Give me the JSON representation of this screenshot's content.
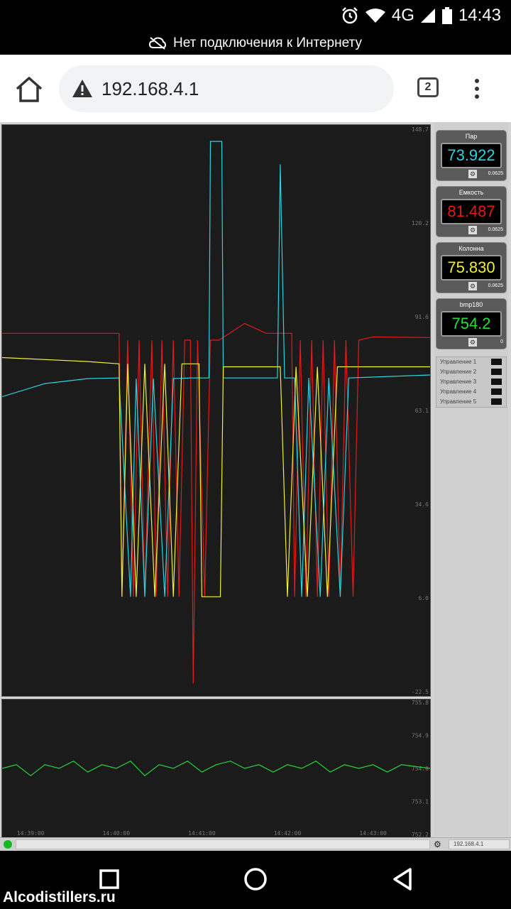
{
  "status_bar": {
    "time": "14:43",
    "network": "4G"
  },
  "offline_banner": {
    "text": "Нет подключения к Интернету"
  },
  "browser": {
    "url": "192.168.4.1",
    "tab_count": "2"
  },
  "main_chart": {
    "y_ticks": [
      "148.7",
      "120.2",
      "91.6",
      "63.1",
      "34.6",
      "6.0",
      "-22.5"
    ]
  },
  "pressure_chart": {
    "y_ticks": [
      "755.8",
      "754.9",
      "754.0",
      "753.1",
      "752.2"
    ],
    "x_ticks": [
      "14:39:00",
      "14:40:00",
      "14:41:00",
      "14:42:00",
      "14:43:00"
    ]
  },
  "gauges": [
    {
      "title": "Пар",
      "value": "73.922",
      "color": "#2ad4e0",
      "step": "0.0625"
    },
    {
      "title": "Емкость",
      "value": "81.487",
      "color": "#e21a1a",
      "step": "0.0625"
    },
    {
      "title": "Колонна",
      "value": "75.830",
      "color": "#f0ef3a",
      "step": "0.0625"
    },
    {
      "title": "bmp180",
      "value": "754.2",
      "color": "#25e03a",
      "step": "0"
    }
  ],
  "controls": [
    "Управление 1",
    "Управление 2",
    "Управление 3",
    "Управление 4",
    "Управление 5"
  ],
  "bottom_bar": {
    "ip": "192.168.4.1"
  },
  "watermark": "Alcodistillers.ru",
  "colors": {
    "steam": "#2ad4e0",
    "tank": "#e21a1a",
    "column": "#f0ef3a",
    "pressure": "#25d53a",
    "status_led": "#15b822"
  },
  "chart_data": [
    {
      "type": "line",
      "y_ticks": [
        148.7,
        120.2,
        91.6,
        63.1,
        34.6,
        6.0,
        -22.5
      ],
      "ylim": [
        -22.5,
        148.7
      ],
      "xlim": [
        "14:38:40",
        "14:43:40"
      ],
      "grid": false,
      "series": [
        {
          "color": "#e21a1a",
          "points": [
            [
              "14:38:40",
              86.6
            ],
            [
              "14:40:02",
              86.6
            ],
            [
              "14:40:04",
              6.4
            ],
            [
              "14:40:08",
              84.5
            ],
            [
              "14:40:12",
              6.4
            ],
            [
              "14:40:16",
              84.5
            ],
            [
              "14:40:20",
              6.4
            ],
            [
              "14:40:25",
              84.5
            ],
            [
              "14:40:28",
              6.4
            ],
            [
              "14:40:32",
              84.5
            ],
            [
              "14:40:36",
              6.4
            ],
            [
              "14:40:40",
              84.5
            ],
            [
              "14:40:44",
              6.4
            ],
            [
              "14:40:48",
              84.5
            ],
            [
              "14:40:52",
              84.5
            ],
            [
              "14:40:54",
              -20.0
            ],
            [
              "14:40:57",
              84.5
            ],
            [
              "14:41:02",
              6.4
            ],
            [
              "14:41:06",
              84.5
            ],
            [
              "14:41:12",
              84.5
            ],
            [
              "14:41:30",
              89.6
            ],
            [
              "14:41:45",
              86.6
            ],
            [
              "14:42:03",
              86.6
            ],
            [
              "14:42:05",
              6.4
            ],
            [
              "14:42:09",
              84.5
            ],
            [
              "14:42:13",
              6.4
            ],
            [
              "14:42:17",
              84.5
            ],
            [
              "14:42:21",
              6.4
            ],
            [
              "14:42:25",
              84.5
            ],
            [
              "14:42:29",
              6.4
            ],
            [
              "14:42:33",
              84.5
            ],
            [
              "14:42:37",
              6.4
            ],
            [
              "14:42:41",
              84.5
            ],
            [
              "14:42:46",
              6.4
            ],
            [
              "14:42:50",
              84.5
            ],
            [
              "14:43:00",
              85.5
            ],
            [
              "14:43:40",
              85.3
            ]
          ]
        },
        {
          "color": "#2ad4e0",
          "points": [
            [
              "14:38:40",
              67.3
            ],
            [
              "14:39:10",
              71.3
            ],
            [
              "14:39:40",
              72.8
            ],
            [
              "14:40:02",
              73.0
            ],
            [
              "14:40:10",
              6.4
            ],
            [
              "14:40:14",
              72.8
            ],
            [
              "14:40:20",
              6.4
            ],
            [
              "14:40:26",
              72.8
            ],
            [
              "14:40:34",
              6.4
            ],
            [
              "14:40:40",
              72.8
            ],
            [
              "14:40:52",
              73.0
            ],
            [
              "14:41:05",
              73.0
            ],
            [
              "14:41:06",
              145.0
            ],
            [
              "14:41:14",
              145.0
            ],
            [
              "14:41:15",
              73.0
            ],
            [
              "14:41:53",
              73.0
            ],
            [
              "14:41:55",
              138.0
            ],
            [
              "14:41:58",
              73.0
            ],
            [
              "14:42:05",
              73.0
            ],
            [
              "14:42:10",
              6.4
            ],
            [
              "14:42:15",
              73.0
            ],
            [
              "14:42:23",
              6.4
            ],
            [
              "14:42:29",
              73.0
            ],
            [
              "14:42:37",
              6.4
            ],
            [
              "14:42:43",
              73.0
            ],
            [
              "14:43:40",
              73.9
            ]
          ]
        },
        {
          "color": "#f0ef3a",
          "points": [
            [
              "14:38:40",
              79.2
            ],
            [
              "14:39:40",
              78.0
            ],
            [
              "14:40:02",
              77.3
            ],
            [
              "14:40:04",
              6.4
            ],
            [
              "14:40:08",
              77.3
            ],
            [
              "14:40:14",
              6.4
            ],
            [
              "14:40:20",
              77.3
            ],
            [
              "14:40:27",
              6.4
            ],
            [
              "14:40:34",
              77.3
            ],
            [
              "14:40:40",
              6.4
            ],
            [
              "14:40:46",
              77.3
            ],
            [
              "14:40:58",
              77.3
            ],
            [
              "14:41:00",
              6.4
            ],
            [
              "14:41:13",
              6.4
            ],
            [
              "14:41:15",
              76.4
            ],
            [
              "14:41:55",
              76.4
            ],
            [
              "14:42:00",
              6.4
            ],
            [
              "14:42:06",
              76.4
            ],
            [
              "14:42:14",
              6.4
            ],
            [
              "14:42:21",
              76.4
            ],
            [
              "14:42:28",
              6.4
            ],
            [
              "14:42:35",
              76.4
            ],
            [
              "14:43:40",
              76.4
            ]
          ]
        }
      ]
    },
    {
      "type": "line",
      "y_ticks": [
        755.8,
        754.9,
        754.0,
        753.1,
        752.2
      ],
      "x_ticks": [
        "14:39:00",
        "14:40:00",
        "14:41:00",
        "14:42:00",
        "14:43:00"
      ],
      "ylim": [
        752.2,
        755.8
      ],
      "xlim": [
        "14:38:40",
        "14:43:40"
      ],
      "grid": false,
      "series": [
        {
          "color": "#25d53a",
          "points": [
            [
              "14:38:40",
              754.0
            ],
            [
              "14:38:50",
              754.1
            ],
            [
              "14:39:00",
              753.8
            ],
            [
              "14:39:10",
              754.1
            ],
            [
              "14:39:20",
              754.0
            ],
            [
              "14:39:30",
              754.2
            ],
            [
              "14:39:40",
              753.9
            ],
            [
              "14:39:50",
              754.1
            ],
            [
              "14:40:00",
              754.0
            ],
            [
              "14:40:10",
              754.2
            ],
            [
              "14:40:20",
              753.8
            ],
            [
              "14:40:30",
              754.1
            ],
            [
              "14:40:40",
              754.0
            ],
            [
              "14:40:50",
              754.2
            ],
            [
              "14:41:00",
              753.9
            ],
            [
              "14:41:10",
              754.1
            ],
            [
              "14:41:20",
              754.2
            ],
            [
              "14:41:30",
              754.0
            ],
            [
              "14:41:40",
              754.1
            ],
            [
              "14:41:50",
              753.9
            ],
            [
              "14:42:00",
              754.1
            ],
            [
              "14:42:10",
              754.0
            ],
            [
              "14:42:20",
              754.2
            ],
            [
              "14:42:30",
              753.9
            ],
            [
              "14:42:40",
              754.1
            ],
            [
              "14:42:50",
              754.0
            ],
            [
              "14:43:00",
              754.1
            ],
            [
              "14:43:10",
              753.9
            ],
            [
              "14:43:20",
              754.1
            ],
            [
              "14:43:40",
              754.0
            ]
          ]
        }
      ]
    }
  ]
}
